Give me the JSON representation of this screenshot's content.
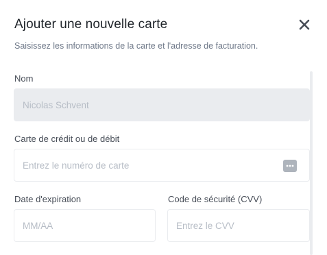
{
  "dialog": {
    "title": "Ajouter une nouvelle carte",
    "subtitle": "Saisissez les informations de la carte et l'adresse de facturation."
  },
  "form": {
    "name": {
      "label": "Nom",
      "value": "Nicolas Schvent",
      "disabled": true
    },
    "card_number": {
      "label": "Carte de crédit ou de débit",
      "placeholder": "Entrez le numéro de carte",
      "icon": "card-icon"
    },
    "expiry": {
      "label": "Date d'expiration",
      "placeholder": "MM/AA"
    },
    "cvv": {
      "label": "Code de sécurité (CVV)",
      "placeholder": "Entrez le CVV"
    }
  },
  "icons": {
    "close": "close-icon"
  },
  "colors": {
    "text_primary": "#1e2329",
    "text_secondary": "#707a8a",
    "placeholder": "#b7bdc6",
    "border": "#eaecef",
    "disabled_bg": "#eaecef"
  }
}
